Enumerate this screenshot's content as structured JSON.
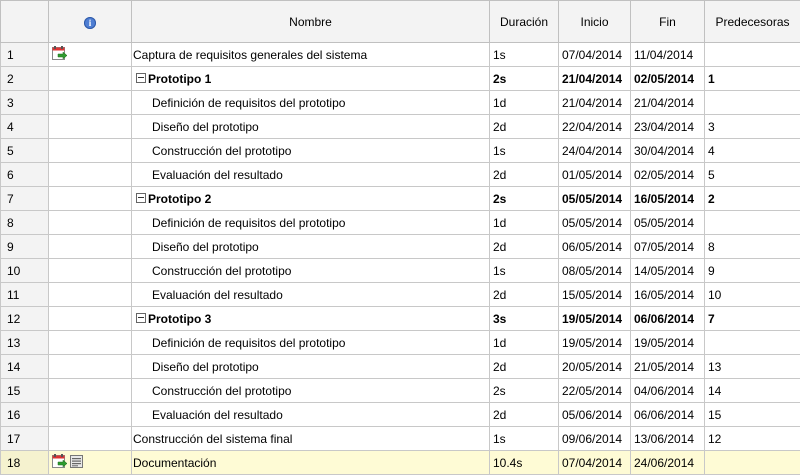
{
  "columns": {
    "num": "",
    "indicator": "i",
    "name": "Nombre",
    "duration": "Duración",
    "start": "Inicio",
    "end": "Fin",
    "predecessors": "Predecesoras"
  },
  "rows": [
    {
      "id": "1",
      "name": "Captura de requisitos generales del sistema",
      "duration": "1s",
      "start": "07/04/2014",
      "end": "11/04/2014",
      "predecessors": "",
      "summary": false,
      "indent": 0,
      "icons": [
        "calendar-task-icon"
      ]
    },
    {
      "id": "2",
      "name": "Prototipo 1",
      "duration": "2s",
      "start": "21/04/2014",
      "end": "02/05/2014",
      "predecessors": "1",
      "summary": true,
      "indent": 0,
      "icons": []
    },
    {
      "id": "3",
      "name": "Definición de requisitos del prototipo",
      "duration": "1d",
      "start": "21/04/2014",
      "end": "21/04/2014",
      "predecessors": "",
      "summary": false,
      "indent": 1,
      "icons": []
    },
    {
      "id": "4",
      "name": "Diseño del prototipo",
      "duration": "2d",
      "start": "22/04/2014",
      "end": "23/04/2014",
      "predecessors": "3",
      "summary": false,
      "indent": 1,
      "icons": []
    },
    {
      "id": "5",
      "name": "Construcción del prototipo",
      "duration": "1s",
      "start": "24/04/2014",
      "end": "30/04/2014",
      "predecessors": "4",
      "summary": false,
      "indent": 1,
      "icons": []
    },
    {
      "id": "6",
      "name": "Evaluación del resultado",
      "duration": "2d",
      "start": "01/05/2014",
      "end": "02/05/2014",
      "predecessors": "5",
      "summary": false,
      "indent": 1,
      "icons": []
    },
    {
      "id": "7",
      "name": "Prototipo 2",
      "duration": "2s",
      "start": "05/05/2014",
      "end": "16/05/2014",
      "predecessors": "2",
      "summary": true,
      "indent": 0,
      "icons": []
    },
    {
      "id": "8",
      "name": "Definición de requisitos del prototipo",
      "duration": "1d",
      "start": "05/05/2014",
      "end": "05/05/2014",
      "predecessors": "",
      "summary": false,
      "indent": 1,
      "icons": []
    },
    {
      "id": "9",
      "name": "Diseño del prototipo",
      "duration": "2d",
      "start": "06/05/2014",
      "end": "07/05/2014",
      "predecessors": "8",
      "summary": false,
      "indent": 1,
      "icons": []
    },
    {
      "id": "10",
      "name": "Construcción del prototipo",
      "duration": "1s",
      "start": "08/05/2014",
      "end": "14/05/2014",
      "predecessors": "9",
      "summary": false,
      "indent": 1,
      "icons": []
    },
    {
      "id": "11",
      "name": "Evaluación del resultado",
      "duration": "2d",
      "start": "15/05/2014",
      "end": "16/05/2014",
      "predecessors": "10",
      "summary": false,
      "indent": 1,
      "icons": []
    },
    {
      "id": "12",
      "name": "Prototipo 3",
      "duration": "3s",
      "start": "19/05/2014",
      "end": "06/06/2014",
      "predecessors": "7",
      "summary": true,
      "indent": 0,
      "icons": []
    },
    {
      "id": "13",
      "name": "Definición de requisitos del prototipo",
      "duration": "1d",
      "start": "19/05/2014",
      "end": "19/05/2014",
      "predecessors": "",
      "summary": false,
      "indent": 1,
      "icons": []
    },
    {
      "id": "14",
      "name": "Diseño del prototipo",
      "duration": "2d",
      "start": "20/05/2014",
      "end": "21/05/2014",
      "predecessors": "13",
      "summary": false,
      "indent": 1,
      "icons": []
    },
    {
      "id": "15",
      "name": "Construcción del prototipo",
      "duration": "2s",
      "start": "22/05/2014",
      "end": "04/06/2014",
      "predecessors": "14",
      "summary": false,
      "indent": 1,
      "icons": []
    },
    {
      "id": "16",
      "name": "Evaluación del resultado",
      "duration": "2d",
      "start": "05/06/2014",
      "end": "06/06/2014",
      "predecessors": "15",
      "summary": false,
      "indent": 1,
      "icons": []
    },
    {
      "id": "17",
      "name": "Construcción del sistema final",
      "duration": "1s",
      "start": "09/06/2014",
      "end": "13/06/2014",
      "predecessors": "12",
      "summary": false,
      "indent": 0,
      "icons": []
    },
    {
      "id": "18",
      "name": "Documentación",
      "duration": "10.4s",
      "start": "07/04/2014",
      "end": "24/06/2014",
      "predecessors": "",
      "summary": false,
      "indent": 0,
      "icons": [
        "calendar-task-icon",
        "notes-icon"
      ],
      "selected": true
    }
  ],
  "colors": {
    "header_bg": "#f3f3f3",
    "grid_line": "#c8c8c8",
    "selected_row_bg": "#fefbd5",
    "info_icon": "#4e7ed3"
  }
}
